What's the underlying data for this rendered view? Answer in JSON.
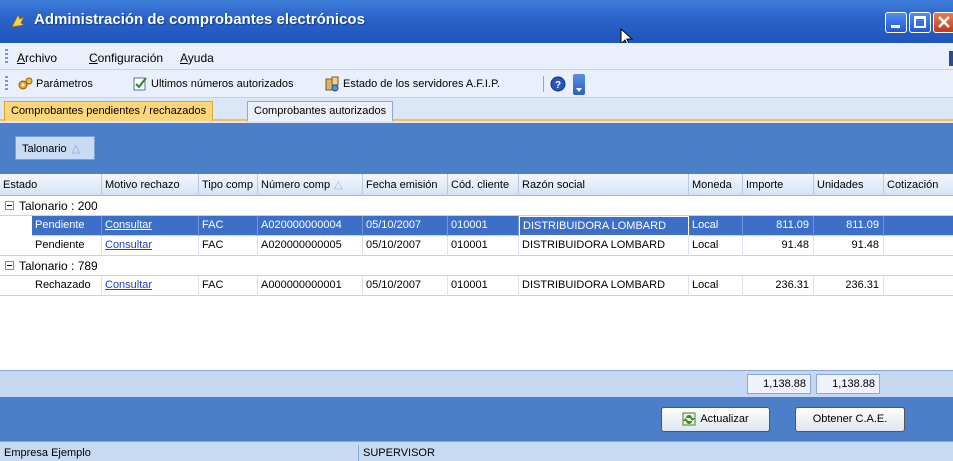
{
  "window": {
    "title": "Administración de comprobantes electrónicos"
  },
  "menubar": {
    "items": [
      "Archivo",
      "Configuración",
      "Ayuda"
    ]
  },
  "toolbar": {
    "parametros": "Parámetros",
    "ultimos": "Ultimos números autorizados",
    "estado": "Estado de los servidores A.F.I.P."
  },
  "tabs": [
    {
      "label": "Comprobantes pendientes / rechazados",
      "active": true
    },
    {
      "label": "Comprobantes autorizados",
      "active": false
    }
  ],
  "group_panel": {
    "chip": "Talonario"
  },
  "grid": {
    "columns": [
      "Estado",
      "Motivo rechazo",
      "Tipo comp",
      "Número comp",
      "Fecha emisión",
      "Cód. cliente",
      "Razón social",
      "Moneda",
      "Importe",
      "Unidades",
      "Cotización"
    ],
    "groups": [
      {
        "title": "Talonario : 200",
        "rows": [
          {
            "estado": "Pendiente",
            "motivo": "Consultar",
            "tipo": "FAC",
            "numero": "A020000000004",
            "fecha": "05/10/2007",
            "cliente": "010001",
            "razon": "DISTRIBUIDORA LOMBARD",
            "moneda": "Local",
            "importe": "811.09",
            "unidades": "811.09",
            "selected": true
          },
          {
            "estado": "Pendiente",
            "motivo": "Consultar",
            "tipo": "FAC",
            "numero": "A020000000005",
            "fecha": "05/10/2007",
            "cliente": "010001",
            "razon": "DISTRIBUIDORA LOMBARD",
            "moneda": "Local",
            "importe": "91.48",
            "unidades": "91.48",
            "selected": false
          }
        ]
      },
      {
        "title": "Talonario : 789",
        "rows": [
          {
            "estado": "Rechazado",
            "motivo": "Consultar",
            "tipo": "FAC",
            "numero": "A000000000001",
            "fecha": "05/10/2007",
            "cliente": "010001",
            "razon": "DISTRIBUIDORA LOMBARD",
            "moneda": "Local",
            "importe": "236.31",
            "unidades": "236.31",
            "selected": false
          }
        ]
      }
    ],
    "totals": {
      "importe": "1,138.88",
      "unidades": "1,138.88"
    }
  },
  "buttons": {
    "actualizar": "Actualizar",
    "obtener": "Obtener C.A.E."
  },
  "statusbar": {
    "empresa": "Empresa Ejemplo",
    "usuario": "SUPERVISOR"
  },
  "colors": {
    "titlebar": "#2a63c9",
    "selected_row": "#3d6fc8",
    "active_tab": "#ffd77a",
    "link": "#1a3fd1"
  }
}
